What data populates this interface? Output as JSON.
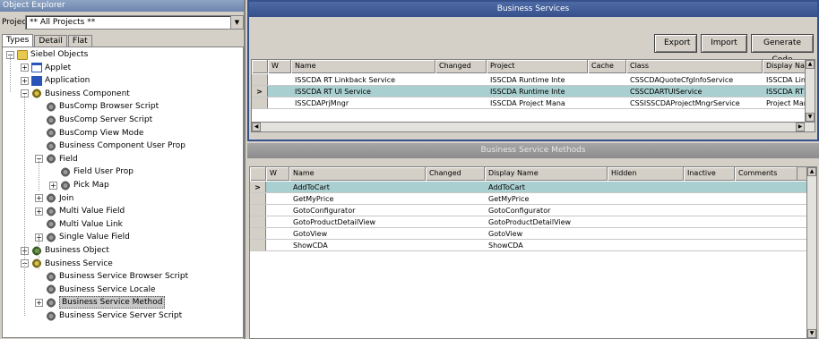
{
  "object_explorer": {
    "title": "Object Explorer",
    "project_label": "Project:",
    "project_value": "** All Projects **",
    "tabs": [
      "Types",
      "Detail",
      "Flat"
    ],
    "tree": [
      {
        "label": "Siebel Objects",
        "icon": "folder-icon",
        "expander": "−"
      },
      {
        "label": "Applet",
        "icon": "applet-icon",
        "expander": "+"
      },
      {
        "label": "Application",
        "icon": "application-icon",
        "expander": "+"
      },
      {
        "label": "Business Component",
        "icon": "business-component-icon",
        "expander": "−"
      },
      {
        "label": "BusComp Browser Script",
        "icon": "gear-icon",
        "expander": ""
      },
      {
        "label": "BusComp Server Script",
        "icon": "gear-icon",
        "expander": ""
      },
      {
        "label": "BusComp View Mode",
        "icon": "gear-icon",
        "expander": ""
      },
      {
        "label": "Business Component User Prop",
        "icon": "gear-icon",
        "expander": ""
      },
      {
        "label": "Field",
        "icon": "gear-icon",
        "expander": "−"
      },
      {
        "label": "Field User Prop",
        "icon": "gear-icon",
        "expander": ""
      },
      {
        "label": "Pick Map",
        "icon": "gear-icon",
        "expander": "+"
      },
      {
        "label": "Join",
        "icon": "gear-icon",
        "expander": "+"
      },
      {
        "label": "Multi Value Field",
        "icon": "gear-icon",
        "expander": "+"
      },
      {
        "label": "Multi Value Link",
        "icon": "gear-icon",
        "expander": ""
      },
      {
        "label": "Single Value Field",
        "icon": "gear-icon",
        "expander": "+"
      },
      {
        "label": "Business Object",
        "icon": "business-object-icon",
        "expander": "+"
      },
      {
        "label": "Business Service",
        "icon": "business-service-icon",
        "expander": "−"
      },
      {
        "label": "Business Service Browser Script",
        "icon": "gear-icon",
        "expander": ""
      },
      {
        "label": "Business Service Locale",
        "icon": "gear-icon",
        "expander": ""
      },
      {
        "label": "Business Service Method",
        "icon": "gear-icon",
        "expander": "+",
        "selected": true
      },
      {
        "label": "Business Service Server Script",
        "icon": "gear-icon",
        "expander": ""
      }
    ]
  },
  "business_services": {
    "title": "Business Services",
    "buttons": [
      "Export",
      "Import",
      "Generate Code"
    ],
    "columns": [
      "W",
      "Name",
      "Changed",
      "Project",
      "Cache",
      "Class",
      "Display Nar"
    ],
    "rows": [
      [
        "",
        "ISSCDA RT Linkback Service",
        "",
        "ISSCDA Runtime Inte",
        "",
        "CSSCDAQuoteCfgInfoService",
        "ISSCDA Lin"
      ],
      [
        "",
        "ISSCDA RT UI Service",
        "",
        "ISSCDA Runtime Inte",
        "",
        "CSSCDARTUIService",
        "ISSCDA RT"
      ],
      [
        "",
        "ISSCDAPrjMngr",
        "",
        "ISSCDA Project Mana",
        "",
        "CSSISSCDAProjectMngrService",
        "Project Mar"
      ]
    ],
    "current_row_marker": ">"
  },
  "business_service_methods": {
    "title": "Business Service Methods",
    "columns": [
      "W",
      "Name",
      "Changed",
      "Display Name",
      "Hidden",
      "Inactive",
      "Comments"
    ],
    "rows": [
      [
        "",
        "AddToCart",
        "",
        "AddToCart",
        "",
        "",
        ""
      ],
      [
        "",
        "GetMyPrice",
        "",
        "GetMyPrice",
        "",
        "",
        ""
      ],
      [
        "",
        "GotoConfigurator",
        "",
        "GotoConfigurator",
        "",
        "",
        ""
      ],
      [
        "",
        "GotoProductDetailView",
        "",
        "GotoProductDetailView",
        "",
        "",
        ""
      ],
      [
        "",
        "GotoView",
        "",
        "GotoView",
        "",
        "",
        ""
      ],
      [
        "",
        "ShowCDA",
        "",
        "ShowCDA",
        "",
        "",
        ""
      ]
    ],
    "current_row_marker": ">"
  }
}
